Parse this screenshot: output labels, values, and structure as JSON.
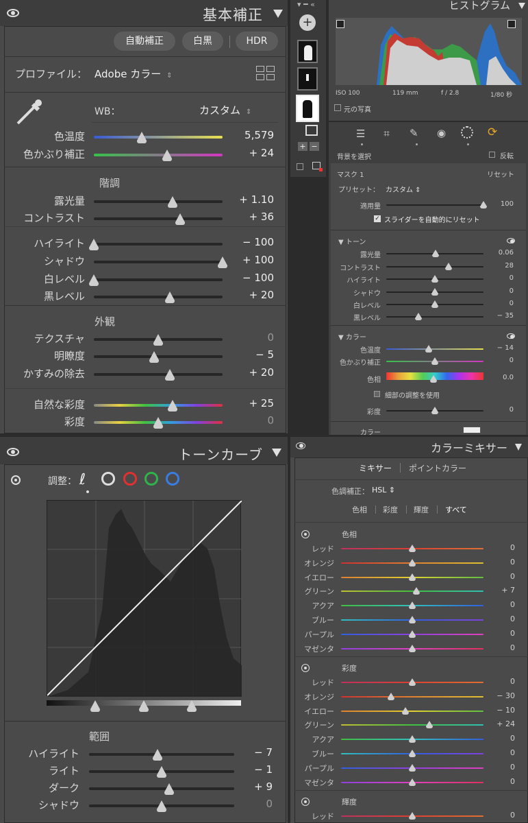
{
  "basic": {
    "title": "基本補正",
    "auto": "自動補正",
    "bw": "白黒",
    "hdr": "HDR",
    "profile_label": "プロファイル：",
    "profile_value": "Adobe カラー",
    "wb_label": "WB：",
    "wb_value": "カスタム",
    "sliders": [
      {
        "label": "色温度",
        "value": "5,579",
        "pos": 0.37,
        "track": "temp"
      },
      {
        "label": "色かぶり補正",
        "value": "+ 24",
        "pos": 0.57,
        "track": "tint"
      },
      {
        "label": "露光量",
        "value": "+ 1.10",
        "pos": 0.61,
        "track": "dark"
      },
      {
        "label": "コントラスト",
        "value": "+ 36",
        "pos": 0.67,
        "track": "dark"
      },
      {
        "label": "ハイライト",
        "value": "− 100",
        "pos": 0.0,
        "track": "dark"
      },
      {
        "label": "シャドウ",
        "value": "+ 100",
        "pos": 1.0,
        "track": "dark"
      },
      {
        "label": "白レベル",
        "value": "− 100",
        "pos": 0.0,
        "track": "dark"
      },
      {
        "label": "黒レベル",
        "value": "+ 20",
        "pos": 0.59,
        "track": "dark"
      },
      {
        "label": "テクスチャ",
        "value": "0",
        "pos": 0.5,
        "track": "dark"
      },
      {
        "label": "明瞭度",
        "value": "− 5",
        "pos": 0.47,
        "track": "dark"
      },
      {
        "label": "かすみの除去",
        "value": "+ 20",
        "pos": 0.59,
        "track": "dark"
      },
      {
        "label": "自然な彩度",
        "value": "+ 25",
        "pos": 0.61,
        "track": "vib"
      },
      {
        "label": "彩度",
        "value": "0",
        "pos": 0.5,
        "track": "sat"
      }
    ],
    "tone_section": "階調",
    "presence_section": "外観"
  },
  "histogram": {
    "title": "ヒストグラム",
    "iso": "ISO 100",
    "focal": "119 mm",
    "aperture": "f / 2.8",
    "shutter": "1/80 秒",
    "original": "元の写真"
  },
  "mask": {
    "select_bg": "背景を選択",
    "invert": "反転",
    "mask_name": "マスク 1",
    "reset": "リセット",
    "preset_label": "プリセット：",
    "preset_value": "カスタム",
    "amount_label": "適用量",
    "amount_value": "100",
    "amount_pos": 1.0,
    "auto_reset": "スライダーを自動的にリセット",
    "tone_title": "トーン",
    "tone": [
      {
        "label": "露光量",
        "value": "0.06",
        "pos": 0.51
      },
      {
        "label": "コントラスト",
        "value": "28",
        "pos": 0.64
      },
      {
        "label": "ハイライト",
        "value": "0",
        "pos": 0.5
      },
      {
        "label": "シャドウ",
        "value": "0",
        "pos": 0.5
      },
      {
        "label": "白レベル",
        "value": "0",
        "pos": 0.5
      },
      {
        "label": "黒レベル",
        "value": "− 35",
        "pos": 0.33
      }
    ],
    "color_title": "カラー",
    "color": [
      {
        "label": "色温度",
        "value": "− 14",
        "pos": 0.44
      },
      {
        "label": "色かぶり補正",
        "value": "0",
        "pos": 0.5
      }
    ],
    "hue_label": "色相",
    "hue_value": "0.0",
    "fine": "細部の調整を使用",
    "sat_label": "彩度",
    "sat_value": "0",
    "color_label": "カラー"
  },
  "tone_curve": {
    "title": "トーンカーブ",
    "adjust": "調整：",
    "range": "範囲",
    "sliders": [
      {
        "label": "ハイライト",
        "value": "− 7",
        "pos": 0.47
      },
      {
        "label": "ライト",
        "value": "− 1",
        "pos": 0.5
      },
      {
        "label": "ダーク",
        "value": "+ 9",
        "pos": 0.55
      },
      {
        "label": "シャドウ",
        "value": "0",
        "pos": 0.5
      }
    ]
  },
  "mixer": {
    "title": "カラーミキサー",
    "tab_mixer": "ミキサー",
    "tab_point": "ポイントカラー",
    "adjust_label": "色調補正：",
    "adjust_value": "HSL",
    "modes": [
      "色相",
      "彩度",
      "輝度",
      "すべて"
    ],
    "hue_title": "色相",
    "hue": [
      {
        "label": "レッド",
        "value": "0",
        "pos": 0.5
      },
      {
        "label": "オレンジ",
        "value": "0",
        "pos": 0.5
      },
      {
        "label": "イエロー",
        "value": "0",
        "pos": 0.5
      },
      {
        "label": "グリーン",
        "value": "+ 7",
        "pos": 0.53
      },
      {
        "label": "アクア",
        "value": "0",
        "pos": 0.5
      },
      {
        "label": "ブルー",
        "value": "0",
        "pos": 0.5
      },
      {
        "label": "パープル",
        "value": "0",
        "pos": 0.5
      },
      {
        "label": "マゼンタ",
        "value": "0",
        "pos": 0.5
      }
    ],
    "sat_title": "彩度",
    "sat": [
      {
        "label": "レッド",
        "value": "0",
        "pos": 0.5
      },
      {
        "label": "オレンジ",
        "value": "− 30",
        "pos": 0.35
      },
      {
        "label": "イエロー",
        "value": "− 10",
        "pos": 0.45
      },
      {
        "label": "グリーン",
        "value": "+ 24",
        "pos": 0.62
      },
      {
        "label": "アクア",
        "value": "0",
        "pos": 0.5
      },
      {
        "label": "ブルー",
        "value": "0",
        "pos": 0.5
      },
      {
        "label": "パープル",
        "value": "0",
        "pos": 0.5
      },
      {
        "label": "マゼンタ",
        "value": "0",
        "pos": 0.5
      }
    ],
    "lum_title": "輝度",
    "lum": [
      {
        "label": "レッド",
        "value": "0",
        "pos": 0.5
      }
    ]
  }
}
